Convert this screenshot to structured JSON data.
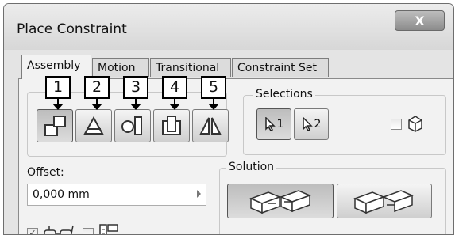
{
  "window": {
    "title": "Place Constraint",
    "close_label": "X"
  },
  "tabs": [
    {
      "label": "Assembly",
      "active": true
    },
    {
      "label": "Motion",
      "active": false
    },
    {
      "label": "Transitional",
      "active": false
    },
    {
      "label": "Constraint Set",
      "active": false
    }
  ],
  "callouts": [
    "1",
    "2",
    "3",
    "4",
    "5"
  ],
  "type_buttons": [
    {
      "icon": "mate-icon",
      "pressed": true
    },
    {
      "icon": "angle-icon",
      "pressed": false
    },
    {
      "icon": "tangent-icon",
      "pressed": false
    },
    {
      "icon": "insert-icon",
      "pressed": false
    },
    {
      "icon": "symmetry-icon",
      "pressed": false
    }
  ],
  "selections": {
    "label": "Selections",
    "first_label": "1",
    "second_label": "2"
  },
  "offset": {
    "label": "Offset:",
    "value": "0,000 mm"
  },
  "solution": {
    "label": "Solution"
  },
  "colors": {
    "callout_border": "#000000",
    "button_pressed": "#bdbdbd"
  }
}
